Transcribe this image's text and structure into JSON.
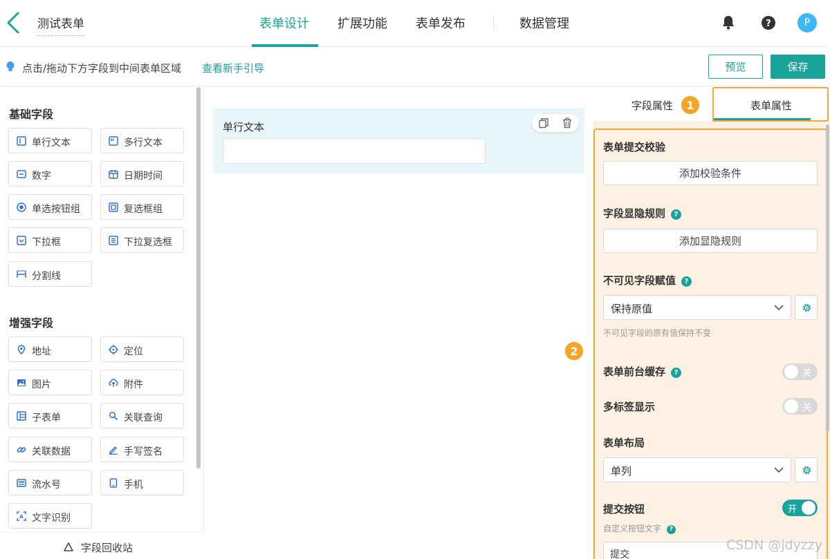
{
  "header": {
    "form_title": "测试表单",
    "tabs": [
      "表单设计",
      "扩展功能",
      "表单发布",
      "数据管理"
    ],
    "avatar_letter": "P",
    "help_glyph": "?"
  },
  "hint": {
    "text": "点击/拖动下方字段到中间表单区域",
    "link": "查看新手引导",
    "preview_label": "预览",
    "save_label": "保存"
  },
  "left": {
    "basic_title": "基础字段",
    "basic_fields": [
      "单行文本",
      "多行文本",
      "数字",
      "日期时间",
      "单选按钮组",
      "复选框组",
      "下拉框",
      "下拉复选框",
      "分割线"
    ],
    "enhanced_title": "增强字段",
    "enhanced_fields": [
      "地址",
      "定位",
      "图片",
      "附件",
      "子表单",
      "关联查询",
      "关联数据",
      "手写签名",
      "流水号",
      "手机",
      "文字识别"
    ],
    "recycle_label": "字段回收站"
  },
  "canvas": {
    "field_label": "单行文本"
  },
  "right": {
    "tab_field": "字段属性",
    "tab_form": "表单属性",
    "badge1": "1",
    "badge2": "2",
    "submit_validation_title": "表单提交校验",
    "add_validation_label": "添加校验条件",
    "visibility_rule_title": "字段显隐规则",
    "add_visibility_label": "添加显隐规则",
    "invisible_assign_title": "不可见字段赋值",
    "invisible_assign_value": "保持原值",
    "invisible_assign_desc": "不可见字段的原有值保持不变",
    "cache_title": "表单前台缓存",
    "cache_toggle": "关",
    "multitab_title": "多标签显示",
    "multitab_toggle": "关",
    "layout_title": "表单布局",
    "layout_value": "单列",
    "submit_btn_title": "提交按钮",
    "submit_btn_toggle": "开",
    "custom_text_desc": "自定义按钮文字",
    "submit_text_value": "提交"
  },
  "watermark": "CSDN @jdyzzy",
  "colors": {
    "accent": "#1aa39a",
    "highlight": "#f3a73c",
    "panel_bg": "#fdf1e4",
    "card_bg": "#e8f5f9"
  }
}
